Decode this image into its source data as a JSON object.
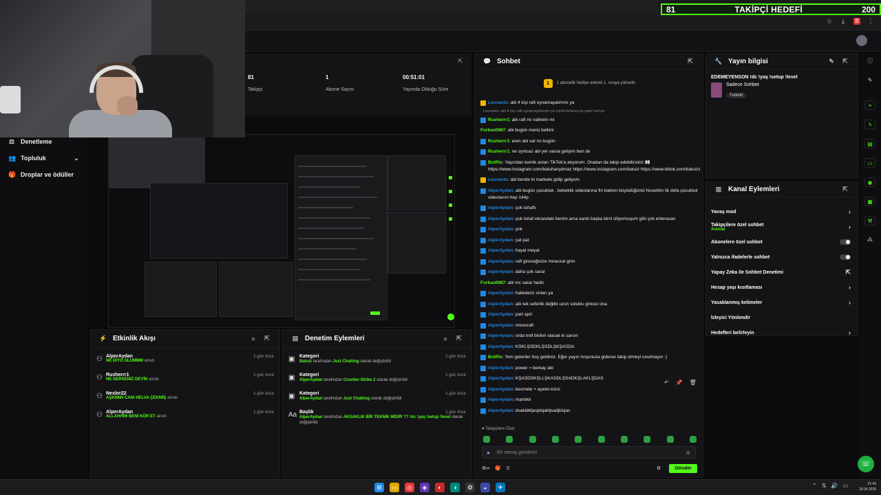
{
  "goal": {
    "current": "81",
    "title": "TAKİPÇİ HEDEFİ",
    "target": "200"
  },
  "stats": [
    {
      "value": "81",
      "label": "Takipçi"
    },
    {
      "value": "1",
      "label": "Abone Sayısı"
    },
    {
      "value": "00:51:01",
      "label": "Yayında Olduğu Süre"
    }
  ],
  "nav": [
    {
      "label": "Denetleme"
    },
    {
      "label": "Topluluk"
    },
    {
      "label": "Droplar ve ödüller"
    }
  ],
  "activity": {
    "title": "Etkinlik Akışı",
    "items": [
      {
        "name": "AlperAydan",
        "desc": "NE DİYO OLUMMM",
        "suffix": "alındı",
        "time": "1 gün önce"
      },
      {
        "name": "Rusherrr1",
        "desc": "NE DERSENİZ DEYİN",
        "suffix": "alındı",
        "time": "1 gün önce"
      },
      {
        "name": "Nexlor22",
        "desc": "AŞKIMIN CANI HELVA ÇEKMİŞ",
        "suffix": "alındı",
        "time": "1 gün önce"
      },
      {
        "name": "AlperAydan",
        "desc": "ALLAHHIM BENİ KÖR ET",
        "suffix": "alındı",
        "time": "1 gün önce"
      }
    ]
  },
  "moderation": {
    "title": "Denetim Eylemleri",
    "items": [
      {
        "name": "Kategori",
        "who": "Batuiz",
        "mid": "tarafından",
        "what": "Just Chatting",
        "end": "olarak değiştirildi",
        "time": "1 gün önce"
      },
      {
        "name": "Kategori",
        "who": "AlperAydan",
        "mid": "tarafından",
        "what": "Counter-Strike 2",
        "end": "olarak değiştirildi",
        "time": "1 gün önce"
      },
      {
        "name": "Kategori",
        "who": "AlperAydan",
        "mid": "tarafından",
        "what": "Just Chatting",
        "end": "olarak değiştirildi",
        "time": "1 gün önce"
      },
      {
        "name": "Başlık",
        "who": "AlperAydan",
        "mid": "tarafından",
        "what": "AKSAKLIK BİR TEKNİK MİDİR ?? !dc !yaş !setup !level",
        "end": "olarak değiştirildi",
        "time": "1 gün önce"
      }
    ]
  },
  "chat": {
    "title": "Sohbet",
    "pinned": "1 abonelik hediye ederek 1. sıraya yükselin",
    "messages": [
      {
        "user": "Leosanto",
        "color": "#1e88e5",
        "gold": true,
        "text": ": abi 4 kişi raft oynamayalımmı ya"
      },
      {
        "reply": "Leosanto: abi 4 kişi raft oynamayalımmı ya isimli kullanıcıya yanıt veriyor"
      },
      {
        "user": "Rusherrr1",
        "color": "#53fc18",
        "text": ": abi raft mı valheim mi"
      },
      {
        "user": "Furkan0987",
        "color": "#53fc18",
        "nobadge": true,
        "text": ": abi bugün menü bellimi"
      },
      {
        "user": "Rusherrr1",
        "color": "#53fc18",
        "text": ": eren abi var mı bugün"
      },
      {
        "user": "Rusherrr1",
        "color": "#53fc18",
        "text": ": ne oynicaz abi yer varsa geliyim ben de"
      },
      {
        "user": "BotRix",
        "color": "#53fc18",
        "text": ": Yayından komik anları TikTok'a atıyorum. Oradan da takip edebilirsiniz 👀 https://www.instagram.com/batuhanyilmaz https://www.instagram.com/batuiz https://www.tiktok.com/batuizz"
      },
      {
        "user": "Leosanto",
        "color": "#1e88e5",
        "gold": true,
        "text": ": abi bende bi markete gidip geliyom"
      },
      {
        "user": "AlperAydan",
        "color": "#1e88e5",
        "text": ": abi bugün çocukluk , bebeklik videolarına fln baktım büyüdüğümü hissettim ilk defa çocukluk videolarım hep 144p"
      },
      {
        "user": "AlperAydan",
        "color": "#1e88e5",
        "text": ": çok tuhaftı"
      },
      {
        "user": "AlperAydan",
        "color": "#1e88e5",
        "text": ": çok tuhaf ekrandaki benim ama sanki başka birni izliyomuşum gibi çok enterasan"
      },
      {
        "user": "AlperAydan",
        "color": "#1e88e5",
        "text": ": yok"
      },
      {
        "user": "AlperAydan",
        "color": "#1e88e5",
        "text": ": çat pat"
      },
      {
        "user": "AlperAydan",
        "color": "#1e88e5",
        "text": ": hayal meyal"
      },
      {
        "user": "AlperAydan",
        "color": "#1e88e5",
        "text": ": raft gireceğinize minecrat girin"
      },
      {
        "user": "AlperAydan",
        "color": "#1e88e5",
        "text": ": daha çok sarar"
      },
      {
        "user": "Furkan0987",
        "color": "#53fc18",
        "nobadge": true,
        "text": ": abi mc sarar harbi"
      },
      {
        "user": "AlperAydan",
        "color": "#1e88e5",
        "text": ": hallederiz onları ya"
      },
      {
        "user": "AlperAydan",
        "color": "#1e88e5",
        "text": ": abi tek seferlik değilki uzun soluklu giricez ona"
      },
      {
        "user": "AlperAydan",
        "color": "#1e88e5",
        "text": ": part aprt"
      },
      {
        "user": "AlperAydan",
        "color": "#1e88e5",
        "text": ": micecraft"
      },
      {
        "user": "AlperAydan",
        "color": "#1e88e5",
        "text": ": orda troll birileri olacak ki sarsın"
      },
      {
        "user": "AlperAydan",
        "color": "#1e88e5",
        "text": ": KSKLŞSDKLŞSDLŞKŞASDA"
      },
      {
        "user": "BotRix",
        "color": "#53fc18",
        "text": ": Yeni gelenler hoş geldiniz. Eğer yayın hoşunuza giderse takip etmeyi unutmayın :)"
      },
      {
        "user": "AlperAydan",
        "color": "#1e88e5",
        "text": ": power = berkay abi"
      },
      {
        "user": "AlperAydan",
        "color": "#1e88e5",
        "text": ": KŞASDSKŞLLŞKASDLŞSADKŞLAKLŞDAS"
      },
      {
        "user": "AlperAydan",
        "color": "#1e88e5",
        "text": ": besmele + ayetel kürsi"
      },
      {
        "user": "AlperAydan",
        "color": "#1e88e5",
        "text": ": mantıklı"
      },
      {
        "user": "AlperAydan",
        "color": "#1e88e5",
        "text": ": dsakldkljasjdsjakljsadjklsjas"
      }
    ],
    "followers_only": "Takipçilere Özel",
    "input_placeholder": "Bir mesaj gönderin",
    "viewer_count": "0",
    "send_label": "Gönder"
  },
  "streaminfo": {
    "title": "Yayın bilgisi",
    "stream_title": "EDEMEYENSON !dc !yaş !setup !level",
    "category": "Sadece Sohbet",
    "language": "Turkish"
  },
  "actions": {
    "title": "Kanal Eylemleri",
    "rows": [
      {
        "label": "Yavaş mod",
        "kind": "chevron"
      },
      {
        "label": "Takipçilere özel sohbet",
        "sub": "Anında",
        "kind": "chevron"
      },
      {
        "label": "Abonelere özel sohbet",
        "kind": "toggle"
      },
      {
        "label": "Yalnızca ifadelerle sohbet",
        "kind": "toggle"
      },
      {
        "label": "Yapay Zeka ile Sohbet Denetimi",
        "kind": "external"
      },
      {
        "label": "Hesap yaşı kısıtlaması",
        "kind": "chevron"
      },
      {
        "label": "Yasaklanmış kelimeler",
        "kind": "chevron"
      },
      {
        "label": "İzleyici Yönlendir",
        "kind": "none"
      },
      {
        "label": "Hedefleri belirleyin",
        "kind": "chevron"
      }
    ]
  },
  "clock": {
    "time": "21:43",
    "date": "18.04.2026"
  },
  "colors": {
    "accent": "#53fc18",
    "panel": "#141416",
    "background": "#0b0b0c"
  }
}
